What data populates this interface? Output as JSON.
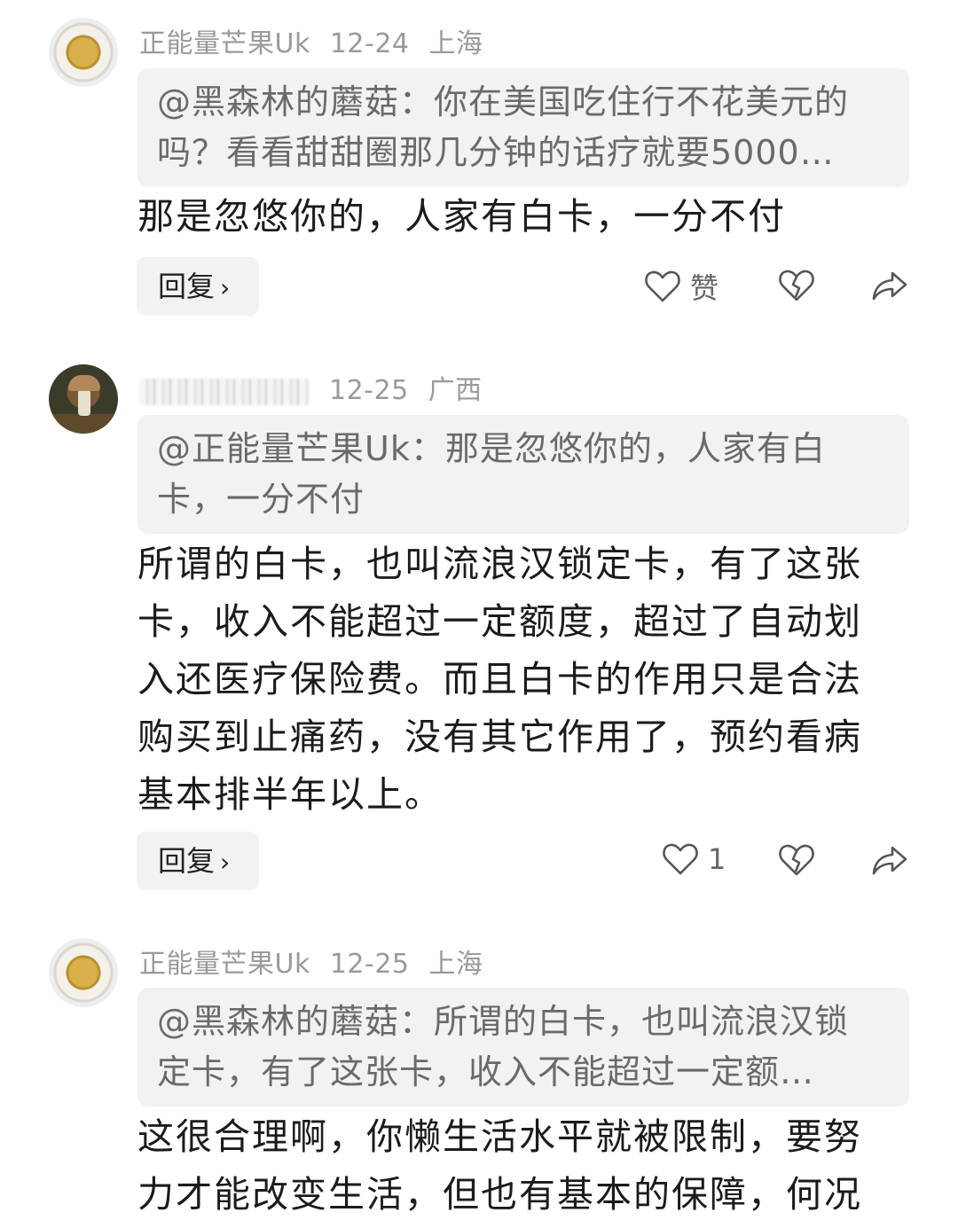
{
  "comments": [
    {
      "author": "正能量芒果Uk",
      "date": "12-24",
      "location": "上海",
      "avatar": "tea-cup-avatar",
      "quote": "@黑森林的蘑菇：你在美国吃住行不花美元的吗？看看甜甜圈那几分钟的话疗就要5000…",
      "text": "那是忽悠你的，人家有白卡，一分不付",
      "reply_label": "回复",
      "like_label": "赞"
    },
    {
      "author": "",
      "date": "12-25",
      "location": "广西",
      "avatar": "mushroom-avatar",
      "quote": "@正能量芒果Uk：那是忽悠你的，人家有白卡，一分不付",
      "text": "所谓的白卡，也叫流浪汉锁定卡，有了这张卡，收入不能超过一定额度，超过了自动划入还医疗保险费。而且白卡的作用只是合法购买到止痛药，没有其它作用了，预约看病基本排半年以上。",
      "reply_label": "回复",
      "like_label": "1"
    },
    {
      "author": "正能量芒果Uk",
      "date": "12-25",
      "location": "上海",
      "avatar": "tea-cup-avatar",
      "quote": "@黑森林的蘑菇：所谓的白卡，也叫流浪汉锁定卡，有了这张卡，收入不能超过一定额…",
      "text": "这很合理啊，你懒生活水平就被限制，要努力才能改变生活，但也有基本的保障，何况"
    }
  ],
  "icons": {
    "like": "heart-outline-icon",
    "dislike": "broken-heart-icon",
    "share": "share-arrow-icon",
    "reply_chevron": "chevron-right-icon"
  },
  "colors": {
    "meta": "#9a9a9a",
    "quote_bg": "#f2f2f2",
    "quote_text": "#6a6a6a",
    "body_text": "#1b1b1b"
  }
}
